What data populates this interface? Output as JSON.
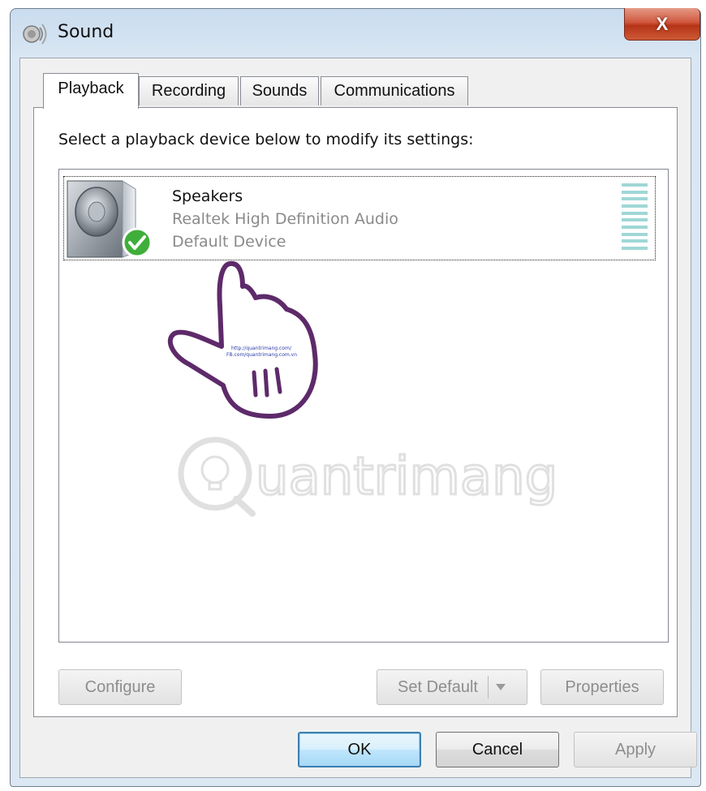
{
  "window": {
    "title": "Sound",
    "close_label": "X"
  },
  "tabs": [
    {
      "label": "Playback",
      "active": true
    },
    {
      "label": "Recording",
      "active": false
    },
    {
      "label": "Sounds",
      "active": false
    },
    {
      "label": "Communications",
      "active": false
    }
  ],
  "panel": {
    "instruction": "Select a playback device below to modify its settings:",
    "devices": [
      {
        "name": "Speakers",
        "driver": "Realtek High Definition Audio",
        "status": "Default Device",
        "icon": "speaker-icon",
        "badge": "default-check-icon"
      }
    ],
    "watermark_text": "uantrimang",
    "hand_text_1": "http://quantrimang.com/",
    "hand_text_2": "FB.com/quantrimang.com.vn"
  },
  "panel_buttons": {
    "configure": "Configure",
    "set_default": "Set Default",
    "properties": "Properties"
  },
  "dialog_buttons": {
    "ok": "OK",
    "cancel": "Cancel",
    "apply": "Apply"
  },
  "colors": {
    "accent": "#3c7fb1",
    "close": "#c94a2e",
    "level_meter": "#9fd7d6",
    "check": "#3fae3a",
    "hand_outline": "#5e2a6a"
  }
}
